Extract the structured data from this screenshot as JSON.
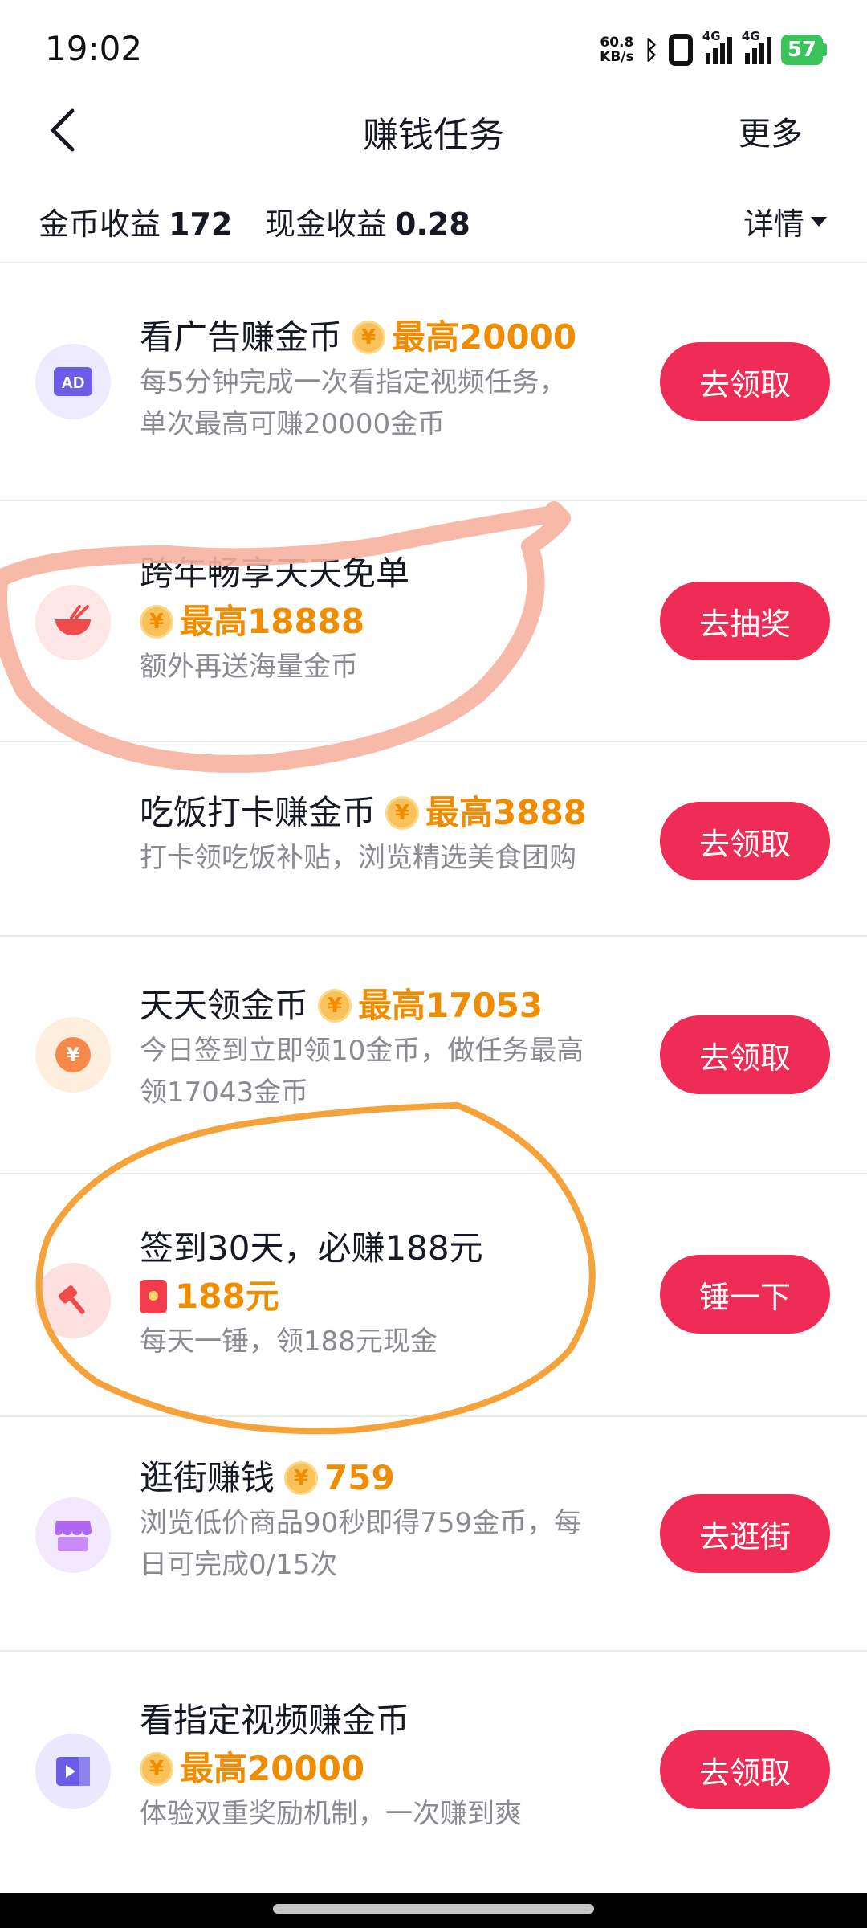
{
  "status_bar": {
    "time": "19:02",
    "net_speed_value": "60.8",
    "net_speed_unit": "KB/s",
    "bluetooth_icon": "bluetooth-icon",
    "signal1_label": "4G",
    "signal2_label": "4G",
    "battery": "57"
  },
  "header": {
    "back_icon": "chevron-left-icon",
    "title": "赚钱任务",
    "more": "更多"
  },
  "earnings": {
    "coin_label": "金币收益",
    "coin_value": "172",
    "cash_label": "现金收益",
    "cash_value": "0.28",
    "details": "详情"
  },
  "tasks": [
    {
      "icon": "ad-icon",
      "icon_text": "AD",
      "title": "看广告赚金币",
      "reward": "最高20000",
      "desc1": "每5分钟完成一次看指定视频任务，",
      "desc2": "单次最高可赚20000金币",
      "button": "去领取"
    },
    {
      "icon": "bowl-icon",
      "title": "跨年畅享天天免单",
      "reward": "最高18888",
      "desc1": "额外再送海量金币",
      "button": "去抽奖"
    },
    {
      "title": "吃饭打卡赚金币",
      "reward": "最高3888",
      "desc1": "打卡领吃饭补贴，浏览精选美食团购",
      "button": "去领取"
    },
    {
      "icon": "yen-coin-icon",
      "title": "天天领金币",
      "reward": "最高17053",
      "desc1": "今日签到立即领10金币，做任务最高",
      "desc2": "领17043金币",
      "button": "去领取"
    },
    {
      "icon": "hammer-icon",
      "title": "签到30天，必赚188元",
      "reward": "188元",
      "desc1": "每天一锤，领188元现金",
      "button": "锤一下"
    },
    {
      "icon": "shop-icon",
      "title": "逛街赚钱",
      "reward": "759",
      "desc1": "浏览低价商品90秒即得759金币，每",
      "desc2": "日可完成0/15次",
      "button": "去逛街"
    },
    {
      "icon": "video-icon",
      "title": "看指定视频赚金币",
      "reward": "最高20000",
      "desc1": "体验双重奖励机制，一次赚到爽",
      "button": "去领取"
    }
  ],
  "coin_symbol": "¥",
  "colors": {
    "accent": "#ee2c55",
    "reward": "#f08c00",
    "annotation_pink": "#f6b19e",
    "annotation_orange": "#f6a23a"
  }
}
